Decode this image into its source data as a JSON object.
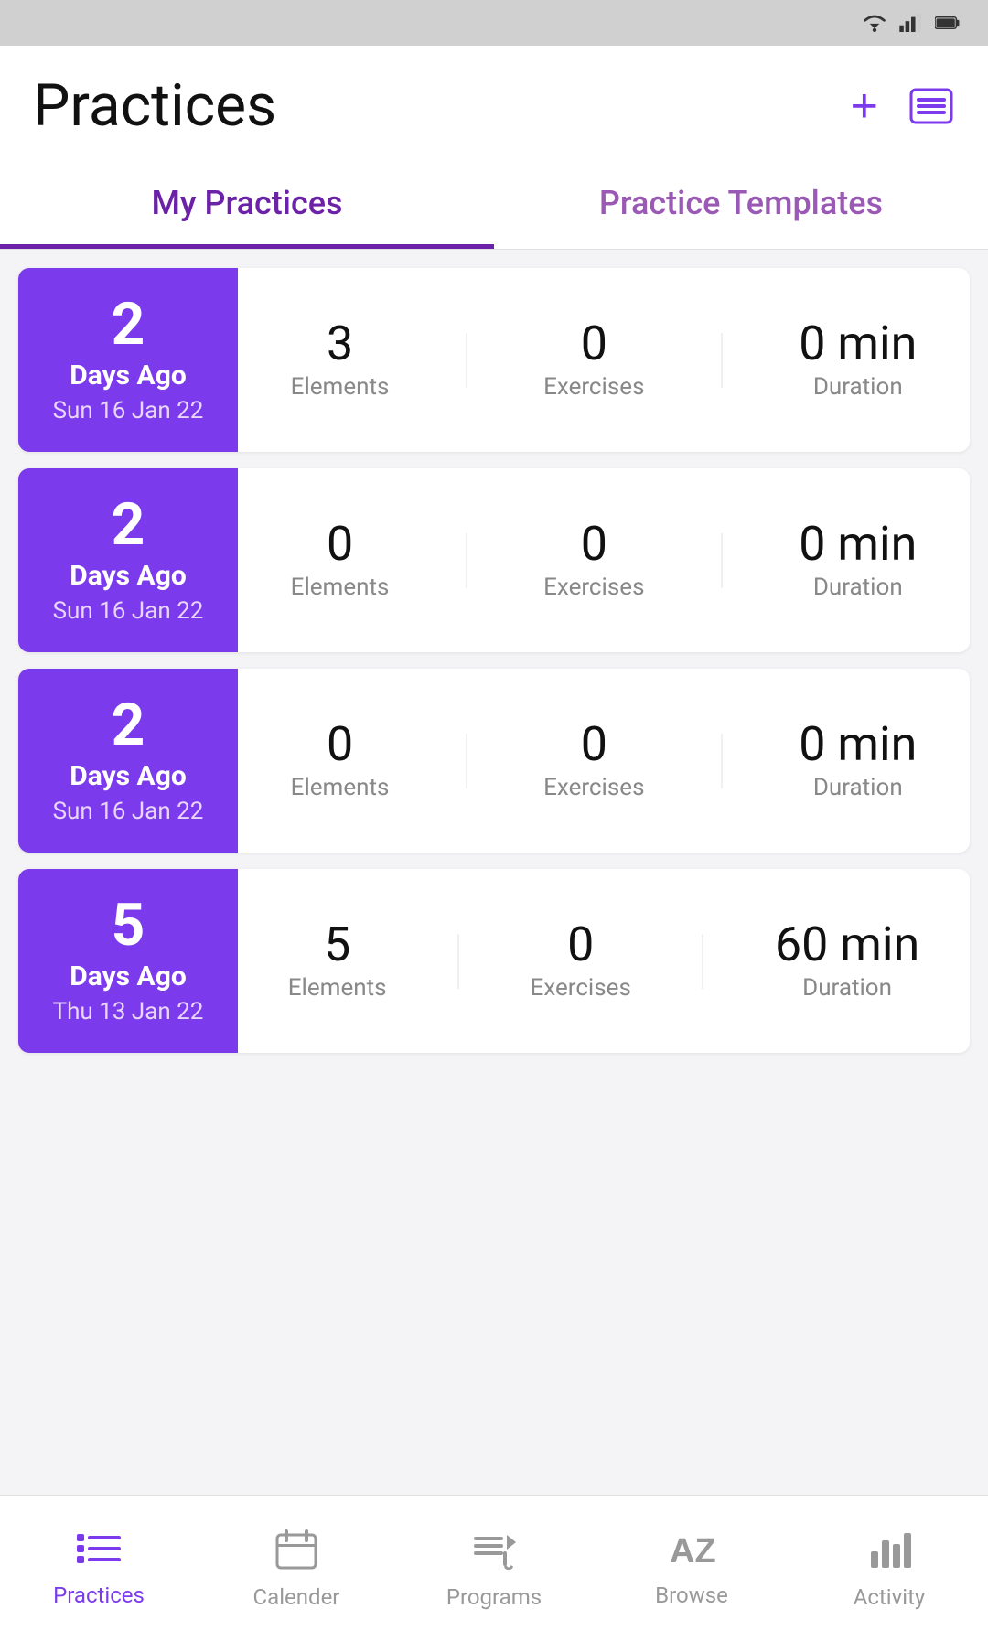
{
  "statusBar": {
    "icons": [
      "wifi",
      "signal",
      "battery"
    ]
  },
  "header": {
    "title": "Practices",
    "addButton": "+",
    "listIcon": "☰"
  },
  "tabs": [
    {
      "id": "my-practices",
      "label": "My Practices",
      "active": true
    },
    {
      "id": "practice-templates",
      "label": "Practice Templates",
      "active": false
    }
  ],
  "practices": [
    {
      "daysNumber": "2",
      "daysLabel": "Days Ago",
      "date": "Sun 16 Jan 22",
      "elements": "3",
      "exercises": "0",
      "durationValue": "0 min",
      "durationLabel": "Duration"
    },
    {
      "daysNumber": "2",
      "daysLabel": "Days Ago",
      "date": "Sun 16 Jan 22",
      "elements": "0",
      "exercises": "0",
      "durationValue": "0 min",
      "durationLabel": "Duration"
    },
    {
      "daysNumber": "2",
      "daysLabel": "Days Ago",
      "date": "Sun 16 Jan 22",
      "elements": "0",
      "exercises": "0",
      "durationValue": "0 min",
      "durationLabel": "Duration"
    },
    {
      "daysNumber": "5",
      "daysLabel": "Days Ago",
      "date": "Thu 13 Jan 22",
      "elements": "5",
      "exercises": "0",
      "durationValue": "60 min",
      "durationLabel": "Duration"
    }
  ],
  "stats": {
    "elementsLabel": "Elements",
    "exercisesLabel": "Exercises"
  },
  "bottomNav": [
    {
      "id": "practices",
      "label": "Practices",
      "icon": "≡•",
      "active": true
    },
    {
      "id": "calendar",
      "label": "Calender",
      "icon": "📅",
      "active": false
    },
    {
      "id": "programs",
      "label": "Programs",
      "icon": "♬",
      "active": false
    },
    {
      "id": "browse",
      "label": "Browse",
      "icon": "AZ",
      "active": false
    },
    {
      "id": "activity",
      "label": "Activity",
      "icon": "📊",
      "active": false
    }
  ]
}
